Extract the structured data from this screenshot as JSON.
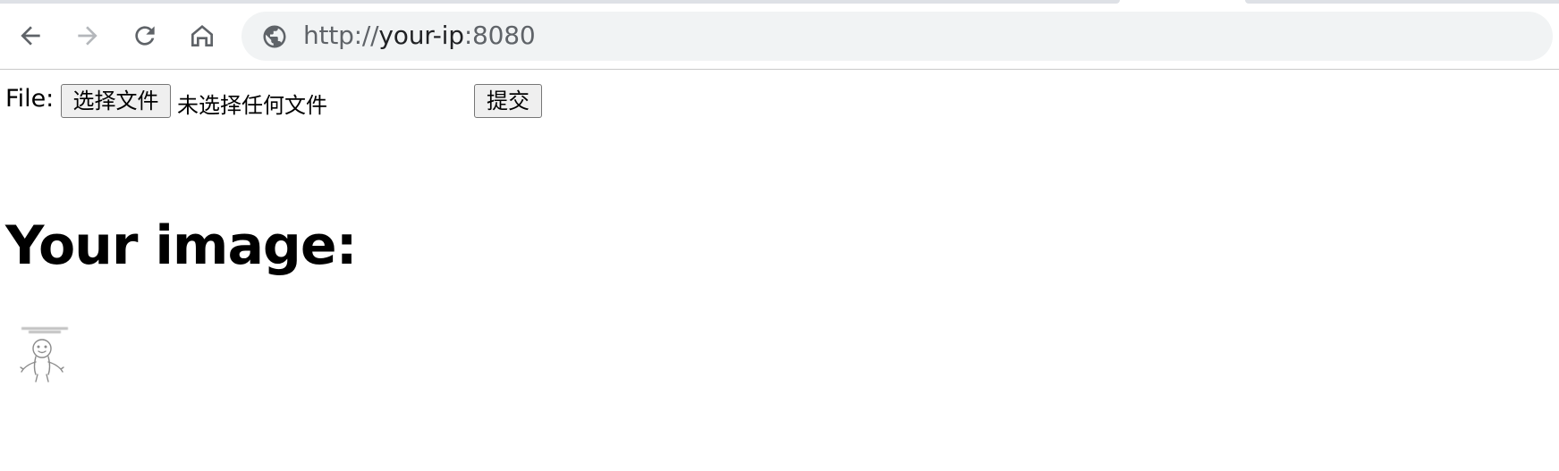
{
  "browser": {
    "nav": {
      "back_icon": "arrow-left-icon",
      "forward_icon": "arrow-right-icon",
      "reload_icon": "reload-icon",
      "home_icon": "home-icon"
    },
    "address_bar": {
      "site_icon": "globe-icon",
      "url_prefix": "http://",
      "url_host": "your-ip",
      "url_port": ":8080"
    }
  },
  "form": {
    "file_label": "File:",
    "choose_button_label": "选择文件",
    "no_file_text": "未选择任何文件",
    "submit_label": "提交"
  },
  "result": {
    "heading": "Your image:",
    "image_caption": "",
    "image_icon": "stickman-meme-image"
  },
  "colors": {
    "tab_strip": "#dee1e6",
    "omnibox_bg": "#f1f3f4",
    "url_text": "#202124",
    "url_dim": "#5f6368",
    "button_bg": "#efefef",
    "button_border": "#767676"
  }
}
